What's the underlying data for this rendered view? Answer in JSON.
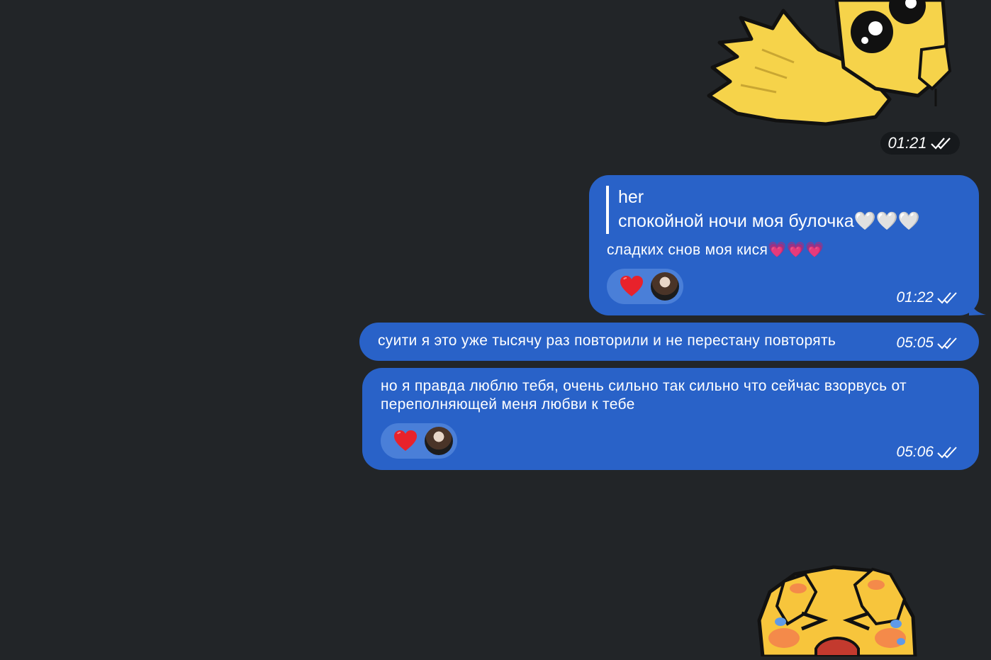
{
  "sticker_top": {
    "time": "01:21"
  },
  "messages": [
    {
      "reply_author": "her",
      "reply_text": "спокойной ночи моя булочка🤍🤍🤍",
      "text": "сладких снов моя кися💗💗💗",
      "time": "01:22",
      "reactions": [
        "heart",
        "avatar"
      ]
    },
    {
      "text": "суити я это уже тысячу раз повторили и не перестану повторять",
      "time": "05:05"
    },
    {
      "text": "но я правда люблю тебя, очень сильно так сильно что сейчас взорвусь от переполняющей меня любви к тебе",
      "time": "05:06",
      "reactions": [
        "heart",
        "avatar"
      ]
    }
  ],
  "colors": {
    "background": "#222528",
    "bubble": "#2962c8",
    "reaction_pill": "#4a7fd8"
  }
}
